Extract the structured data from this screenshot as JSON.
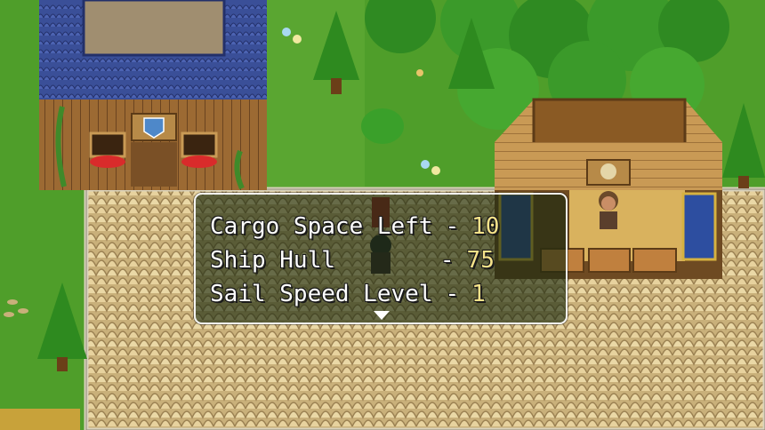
{
  "message_window": {
    "rows": [
      {
        "label": "Cargo Space Left",
        "separator": "-",
        "value": "10"
      },
      {
        "label": "Ship Hull",
        "separator": "-",
        "value": "75"
      },
      {
        "label": "Sail Speed Level",
        "separator": "-",
        "value": "1"
      }
    ],
    "continue_indicator": "down-arrow-icon"
  },
  "colors": {
    "grass": "#4f9e2a",
    "value_text": "#f6e38a",
    "window_border": "#f4f4f4"
  }
}
